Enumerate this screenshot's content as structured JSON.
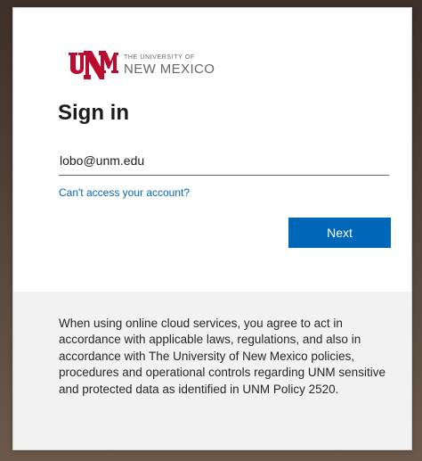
{
  "logo": {
    "line1": "THE UNIVERSITY OF",
    "line2": "NEW MEXICO",
    "brand_color": "#ba0c2f"
  },
  "signin": {
    "title": "Sign in",
    "email_value": "lobo@unm.edu",
    "cant_access_link": "Can't access your account?",
    "next_label": "Next",
    "accent_color": "#0067b8"
  },
  "footer": {
    "notice": "When using online cloud services, you agree to act in accordance with applicable laws, regulations, and also in accordance with The University of New Mexico policies, procedures and operational controls regarding UNM sensitive and protected data as identified in UNM Policy 2520."
  }
}
